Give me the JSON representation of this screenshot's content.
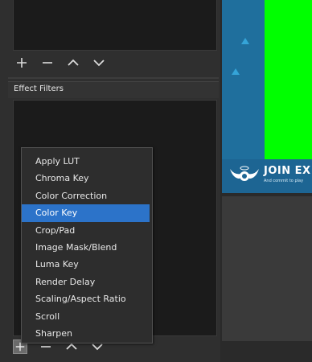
{
  "filters_panel": {
    "title": "Effect Filters"
  },
  "toolbar_icons": [
    "plus-icon",
    "minus-icon",
    "chevron-up-icon",
    "chevron-down-icon"
  ],
  "preview": {
    "banner_text": "JOIN EX",
    "banner_subtext": "And commit to play",
    "colors": {
      "background": "#1f6f9d",
      "green_screen": "#00ff00",
      "triangle": "#35a4d8"
    }
  },
  "context_menu": {
    "selected_index": 3,
    "items": [
      {
        "label": "Apply LUT"
      },
      {
        "label": "Chroma Key"
      },
      {
        "label": "Color Correction"
      },
      {
        "label": "Color Key"
      },
      {
        "label": "Crop/Pad"
      },
      {
        "label": "Image Mask/Blend"
      },
      {
        "label": "Luma Key"
      },
      {
        "label": "Render Delay"
      },
      {
        "label": "Scaling/Aspect Ratio"
      },
      {
        "label": "Scroll"
      },
      {
        "label": "Sharpen"
      }
    ]
  },
  "accent_color": "#2c73c9"
}
